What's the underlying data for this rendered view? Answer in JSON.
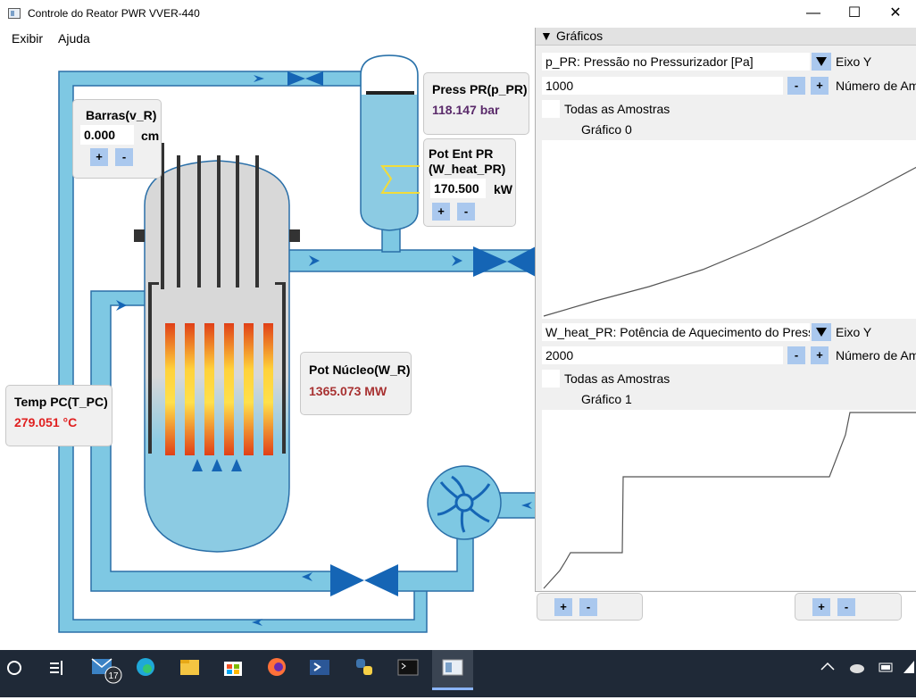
{
  "window": {
    "title": "Controle do Reator PWR VVER-440",
    "minimize": "—",
    "maximize": "☐",
    "close": "✕"
  },
  "menu": {
    "items": [
      "Exibir",
      "Ajuda"
    ]
  },
  "reactor": {
    "bars": {
      "label": "Barras(v_R)",
      "value": "0.000",
      "unit": "cm",
      "plus": "+",
      "minus": "-"
    },
    "pressure": {
      "label": "Press PR(p_PR)",
      "value": "118.147 bar",
      "color": "#5a2a6a"
    },
    "heater": {
      "label_line1": "Pot Ent PR",
      "label_line2": "(W_heat_PR)",
      "value": "170.500",
      "unit": "kW",
      "plus": "+",
      "minus": "-"
    },
    "core_power": {
      "label": "Pot Núcleo(W_R)",
      "value": "1365.073 MW",
      "color": "#a83232"
    },
    "temperature": {
      "label": "Temp PC(T_PC)",
      "value": "279.051 °C",
      "color": "#e02020"
    }
  },
  "graphs": {
    "header": "Gráficos",
    "graph0": {
      "variable": "p_PR: Pressão no Pressurizador [Pa]",
      "axis_label": "Eixo Y",
      "samples_value": "1000",
      "samples_label": "Número de Amostras",
      "minus": "-",
      "plus": "+",
      "all_samples": "Todas as Amostras",
      "title": "Gráfico 0"
    },
    "graph1": {
      "variable": "W_heat_PR: Potência de Aquecimento do Pressurizador",
      "axis_label": "Eixo Y",
      "samples_value": "2000",
      "samples_label": "Número de Amostras",
      "minus": "-",
      "plus": "+",
      "all_samples": "Todas as Amostras",
      "title": "Gráfico 1"
    },
    "bottom_left": {
      "plus": "+",
      "minus": "-"
    },
    "bottom_right": {
      "plus": "+",
      "minus": "-"
    }
  },
  "taskbar": {
    "mail_badge": "17"
  },
  "colors": {
    "pipe": "#7ec8e3",
    "pipe_edge": "#2a6fa8",
    "valve": "#1565b5",
    "accent": "#aac8ee"
  }
}
